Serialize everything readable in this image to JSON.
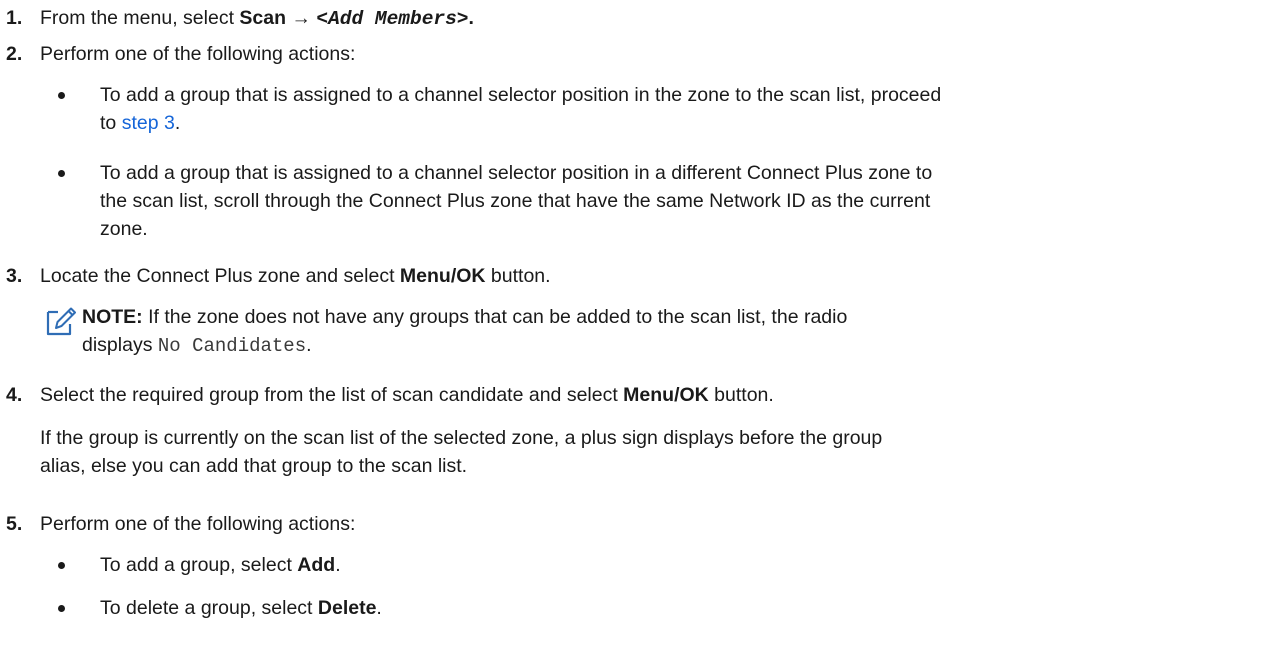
{
  "steps": [
    {
      "num": "1.",
      "pre": "From the menu, select ",
      "bold": "Scan",
      "arrow": " → ",
      "mono": "<Add Members>",
      "post": "."
    },
    {
      "num": "2.",
      "text": "Perform one of the following actions:",
      "bullets": [
        {
          "line1": "To add a group that is assigned to a channel selector position in the zone to the scan list, proceed",
          "line2_pre": "to ",
          "link": "step 3",
          "line2_post": "."
        },
        {
          "line1": "To add a group that is assigned to a channel selector position in a different Connect Plus zone to",
          "line2": "the scan list, scroll through the Connect Plus zone that have the same Network ID as the current",
          "line3": "zone."
        }
      ]
    },
    {
      "num": "3.",
      "pre": "Locate the Connect Plus zone and select ",
      "bold": "Menu/OK",
      "post": " button.",
      "note": {
        "label": "NOTE:",
        "line1": " If the zone does not have any groups that can be added to the scan list, the radio",
        "line2_pre": "displays ",
        "mono": "No Candidates",
        "line2_post": "."
      }
    },
    {
      "num": "4.",
      "pre": "Select the required group from the list of scan candidate and select ",
      "bold": "Menu/OK",
      "post": " button.",
      "para_line1": "If the group is currently on the scan list of the selected zone, a plus sign displays before the group",
      "para_line2": "alias, else you can add that group to the scan list."
    },
    {
      "num": "5.",
      "text": "Perform one of the following actions:",
      "bullets": [
        {
          "pre": "To add a group, select ",
          "bold": "Add",
          "post": "."
        },
        {
          "pre": "To delete a group, select ",
          "bold": "Delete",
          "post": "."
        }
      ]
    }
  ]
}
